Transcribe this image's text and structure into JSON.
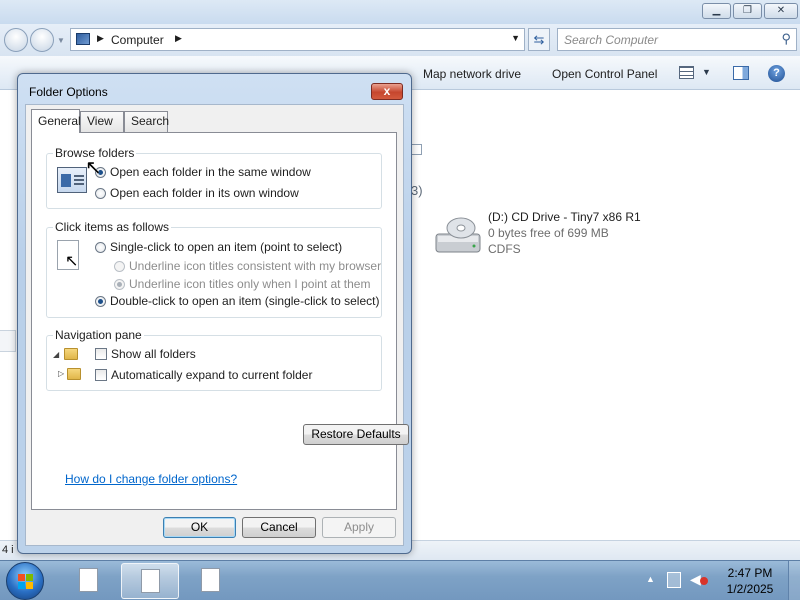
{
  "explorer": {
    "address": {
      "crumb": "Computer",
      "back": "back",
      "forward": "forward"
    },
    "search": {
      "placeholder": "Search Computer"
    },
    "toolbar": {
      "map_network_drive": "Map network drive",
      "open_control_panel": "Open Control Panel"
    },
    "content": {
      "partial_count_text": "3)",
      "cd_drive": {
        "name": "(D:) CD Drive - Tiny7 x86 R1",
        "free": "0 bytes free of 699 MB",
        "filesystem": "CDFS"
      }
    },
    "status": {
      "count_text": "4 i"
    }
  },
  "dialog": {
    "title": "Folder Options",
    "close": "x",
    "tabs": [
      "General",
      "View",
      "Search"
    ],
    "active_tab": "General",
    "browse_folders": {
      "legend": "Browse folders",
      "options": [
        {
          "label": "Open each folder in the same window",
          "checked": true
        },
        {
          "label": "Open each folder in its own window",
          "checked": false
        }
      ]
    },
    "click_items": {
      "legend": "Click items as follows",
      "single_click": {
        "label": "Single-click to open an item (point to select)",
        "checked": false
      },
      "underline_browser": {
        "label": "Underline icon titles consistent with my browser",
        "checked": false,
        "disabled": true
      },
      "underline_point": {
        "label": "Underline icon titles only when I point at them",
        "checked": true,
        "disabled": true
      },
      "double_click": {
        "label": "Double-click to open an item (single-click to select)",
        "checked": true
      }
    },
    "navigation_pane": {
      "legend": "Navigation pane",
      "show_all_folders": {
        "label": "Show all folders",
        "checked": false
      },
      "auto_expand": {
        "label": "Automatically expand to current folder",
        "checked": false
      }
    },
    "restore_defaults": "Restore Defaults",
    "help_link": "How do I change folder options?",
    "buttons": {
      "ok": "OK",
      "cancel": "Cancel",
      "apply": "Apply"
    }
  },
  "taskbar": {
    "clock": {
      "time": "2:47 PM",
      "date": "1/2/2025"
    },
    "colors": {
      "start_orb": "#2a6fc4",
      "taskbar": "#7ea2c6"
    }
  },
  "colors": {
    "link": "#0066cc",
    "close_button": "#c6462e",
    "dialog_frame": "#b8cfe9"
  }
}
